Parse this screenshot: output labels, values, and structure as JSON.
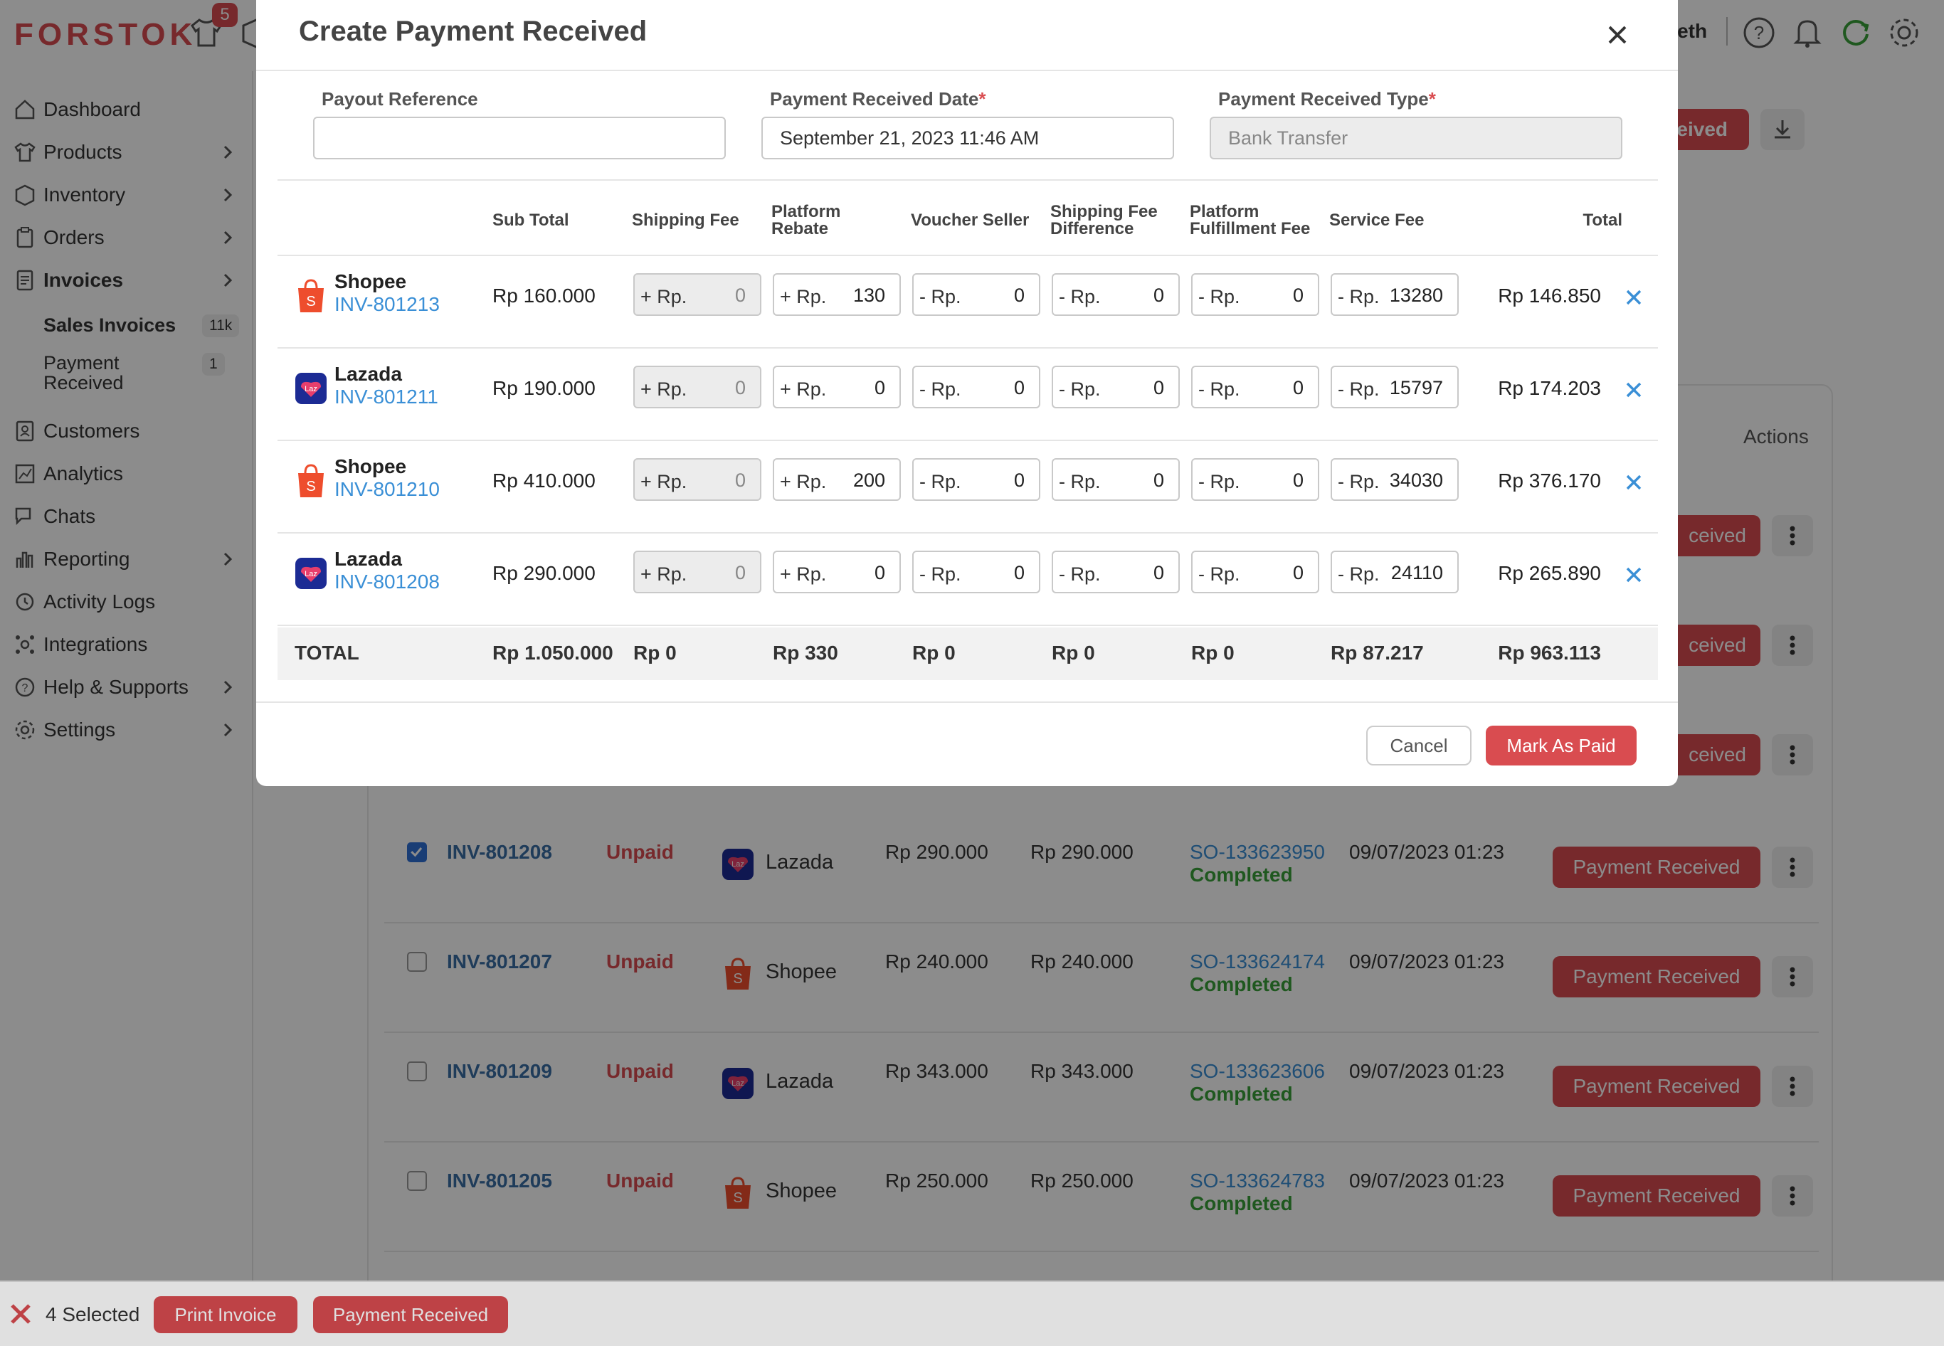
{
  "app": {
    "logo": "FORSTOK",
    "notification_count": "5",
    "user_name": "beth"
  },
  "sidebar": {
    "dashboard": "Dashboard",
    "products": "Products",
    "inventory": "Inventory",
    "orders": "Orders",
    "invoices": "Invoices",
    "sales_invoices": "Sales Invoices",
    "sales_invoices_count": "11k",
    "payment_received": "Payment\nReceived",
    "payment_received_count": "1",
    "customers": "Customers",
    "analytics": "Analytics",
    "chats": "Chats",
    "reporting": "Reporting",
    "activity_logs": "Activity Logs",
    "integrations": "Integrations",
    "help": "Help & Supports",
    "settings": "Settings"
  },
  "page": {
    "top_button_partial": "eived",
    "actions_header": "Actions",
    "partial_button": "ceived"
  },
  "invoice_rows": [
    {
      "inv": "INV-801208",
      "status": "Unpaid",
      "marketplace": "Lazada",
      "amount1": "Rp 290.000",
      "amount2": "Rp 290.000",
      "so": "SO-133623950",
      "so_status": "Completed",
      "date": "09/07/2023 01:23",
      "action": "Payment Received"
    },
    {
      "inv": "INV-801207",
      "status": "Unpaid",
      "marketplace": "Shopee",
      "amount1": "Rp 240.000",
      "amount2": "Rp 240.000",
      "so": "SO-133624174",
      "so_status": "Completed",
      "date": "09/07/2023 01:23",
      "action": "Payment Received"
    },
    {
      "inv": "INV-801209",
      "status": "Unpaid",
      "marketplace": "Lazada",
      "amount1": "Rp 343.000",
      "amount2": "Rp 343.000",
      "so": "SO-133623606",
      "so_status": "Completed",
      "date": "09/07/2023 01:23",
      "action": "Payment Received"
    },
    {
      "inv": "INV-801205",
      "status": "Unpaid",
      "marketplace": "Shopee",
      "amount1": "Rp 250.000",
      "amount2": "Rp 250.000",
      "so": "SO-133624783",
      "so_status": "Completed",
      "date": "09/07/2023 01:23",
      "action": "Payment Received"
    }
  ],
  "bottom_bar": {
    "selected": "4 Selected",
    "print_invoice": "Print Invoice",
    "payment_received": "Payment Received"
  },
  "modal": {
    "title": "Create Payment Received",
    "payout_reference_label": "Payout Reference",
    "payout_reference_value": "",
    "payment_date_label": "Payment Received Date",
    "payment_date_value": "September 21, 2023 11:46 AM",
    "payment_type_label": "Payment Received Type",
    "payment_type_value": "Bank Transfer",
    "required_mark": "*",
    "columns": {
      "sub_total": "Sub Total",
      "shipping_fee": "Shipping Fee",
      "platform_rebate": "Platform\nRebate",
      "voucher_seller": "Voucher Seller",
      "shipping_fee_difference": "Shipping Fee\nDifference",
      "platform_fulfillment_fee": "Platform\nFulfillment Fee",
      "service_fee": "Service Fee",
      "total": "Total"
    },
    "prefix_plus": "+ Rp.",
    "prefix_minus": "- Rp.",
    "rows": [
      {
        "marketplace": "Shopee",
        "invoice": "INV-801213",
        "sub_total": "Rp 160.000",
        "shipping_fee": "0",
        "platform_rebate": "130",
        "voucher_seller": "0",
        "shipping_fee_difference": "0",
        "platform_fulfillment_fee": "0",
        "service_fee": "13280",
        "total": "Rp 146.850"
      },
      {
        "marketplace": "Lazada",
        "invoice": "INV-801211",
        "sub_total": "Rp 190.000",
        "shipping_fee": "0",
        "platform_rebate": "0",
        "voucher_seller": "0",
        "shipping_fee_difference": "0",
        "platform_fulfillment_fee": "0",
        "service_fee": "15797",
        "total": "Rp 174.203"
      },
      {
        "marketplace": "Shopee",
        "invoice": "INV-801210",
        "sub_total": "Rp 410.000",
        "shipping_fee": "0",
        "platform_rebate": "200",
        "voucher_seller": "0",
        "shipping_fee_difference": "0",
        "platform_fulfillment_fee": "0",
        "service_fee": "34030",
        "total": "Rp 376.170"
      },
      {
        "marketplace": "Lazada",
        "invoice": "INV-801208",
        "sub_total": "Rp 290.000",
        "shipping_fee": "0",
        "platform_rebate": "0",
        "voucher_seller": "0",
        "shipping_fee_difference": "0",
        "platform_fulfillment_fee": "0",
        "service_fee": "24110",
        "total": "Rp 265.890"
      }
    ],
    "totals": {
      "label": "TOTAL",
      "sub_total": "Rp 1.050.000",
      "shipping_fee": "Rp 0",
      "platform_rebate": "Rp 330",
      "voucher_seller": "Rp 0",
      "shipping_fee_difference": "Rp 0",
      "platform_fulfillment_fee": "Rp 0",
      "service_fee": "Rp 87.217",
      "total": "Rp 963.113"
    },
    "cancel": "Cancel",
    "mark_as_paid": "Mark As Paid"
  },
  "colors": {
    "brand_red": "#d94c50",
    "link_blue": "#3a8fd6",
    "completed_green": "#3aa03a"
  }
}
